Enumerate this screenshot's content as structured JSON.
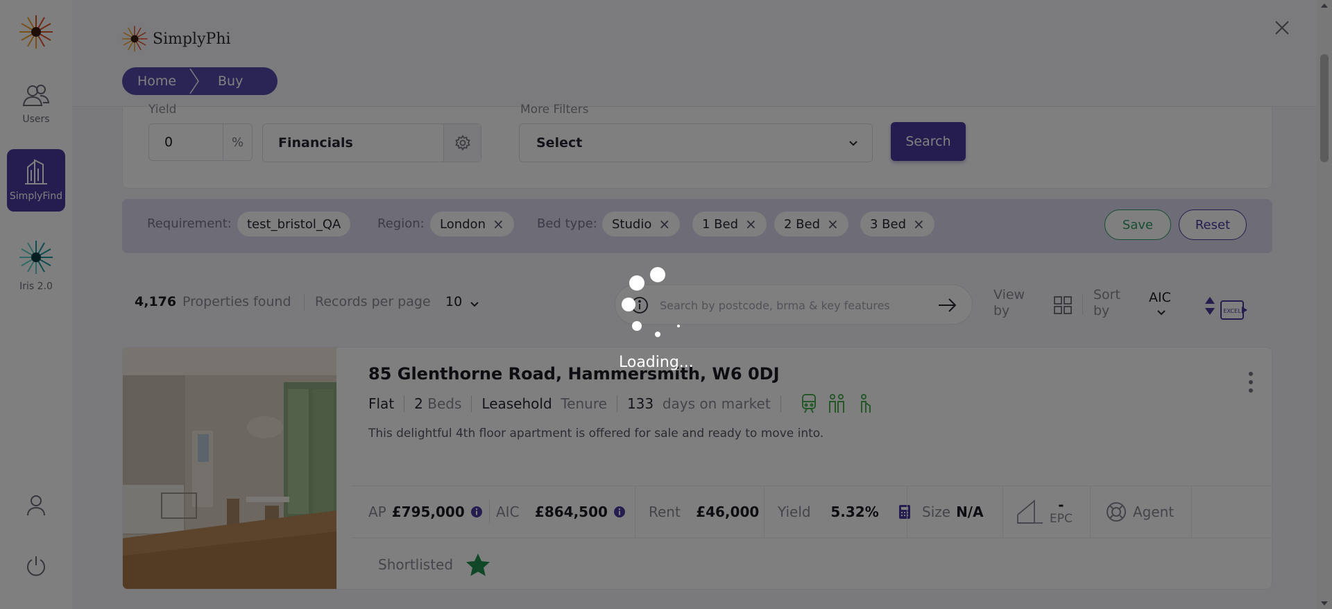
{
  "nav": {
    "items": [
      {
        "label": "Users",
        "icon": "users-icon"
      },
      {
        "label": "SimplyFind",
        "icon": "buildings-icon",
        "active": true
      },
      {
        "label": "Iris 2.0",
        "icon": "iris-logo"
      }
    ],
    "bottom_icons": [
      "account-icon",
      "power-icon"
    ]
  },
  "header": {
    "brand": "SimplyPhi",
    "breadcrumb": {
      "home": "Home",
      "current": "Buy"
    }
  },
  "filters": {
    "yield_label": "Yield",
    "yield_value": "0",
    "yield_unit": "%",
    "financials": "Financials",
    "more_filters_label": "More Filters",
    "more_filters_value": "Select",
    "search_button": "Search"
  },
  "tags": {
    "requirement_label": "Requirement:",
    "requirement": "test_bristol_QA",
    "region_label": "Region:",
    "region": "London",
    "bed_type_label": "Bed type:",
    "bed_types": [
      "Studio",
      "1 Bed",
      "2 Bed",
      "3 Bed"
    ],
    "remove_symbol": "×",
    "save": "Save",
    "reset": "Reset"
  },
  "results": {
    "count": "4,176",
    "found_label": "Properties found",
    "records_label": "Records per page",
    "records_value": "10",
    "search_placeholder": "Search by postcode, brma & key features",
    "view_label_1": "View",
    "view_label_2": "by",
    "sort_label_1": "Sort",
    "sort_label_2": "by",
    "sort_value": "AIC",
    "export_label": "EXCEL"
  },
  "property": {
    "title": "85 Glenthorne Road, Hammersmith, W6 0DJ",
    "type": "Flat",
    "beds": "2",
    "beds_label": "Beds",
    "tenure": "Leasehold",
    "tenure_label": "Tenure",
    "days": "133",
    "days_label": "days on market",
    "description": "This delightful 4th floor apartment is offered for sale and ready to move into.",
    "ap_label": "AP",
    "ap_value": "£795,000",
    "aic_label": "AIC",
    "aic_value": "£864,500",
    "rent_label": "Rent",
    "rent_value": "£46,000",
    "yield_label": "Yield",
    "yield_value": "5.32%",
    "size_label": "Size",
    "size_value": "N/A",
    "epc_value": "-",
    "epc_label": "EPC",
    "agent_label": "Agent",
    "shortlisted_label": "Shortlisted"
  },
  "overlay": {
    "loading_text": "Loading..."
  },
  "colors": {
    "primary": "#4a3ba0",
    "green": "#2f9a62",
    "amenity_green": "#4caf50"
  }
}
